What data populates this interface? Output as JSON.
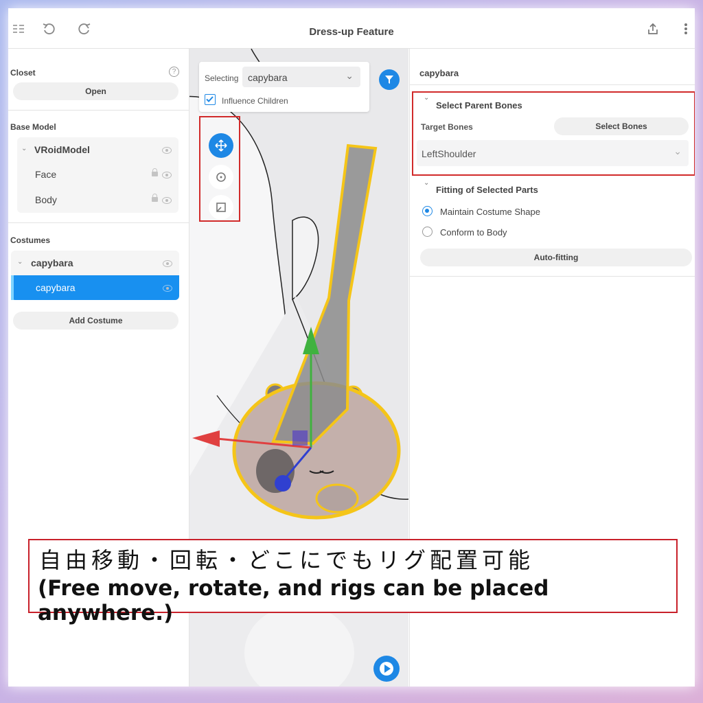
{
  "header": {
    "title": "Dress-up Feature",
    "icons": [
      "menu-icon",
      "undo-icon",
      "redo-icon",
      "share-icon",
      "more-icon"
    ]
  },
  "left_panel": {
    "closet_title": "Closet",
    "open_label": "Open",
    "base_model_title": "Base Model",
    "model_name": "VRoidModel",
    "model_items": [
      "Face",
      "Body"
    ],
    "costumes_title": "Costumes",
    "costume_group": "capybara",
    "costume_selected": "capybara",
    "add_costume_label": "Add Costume"
  },
  "viewport": {
    "selecting_label": "Selecting",
    "selecting_value": "capybara",
    "influence_children_label": "Influence Children",
    "influence_children_checked": true,
    "tools": [
      "move-tool-icon",
      "rotate-tool-icon",
      "scale-tool-icon"
    ]
  },
  "right_panel": {
    "title": "capybara",
    "select_parent_bones_title": "Select Parent Bones",
    "target_bones_label": "Target Bones",
    "select_bones_button": "Select Bones",
    "bone_value": "LeftShoulder",
    "fitting_title": "Fitting of Selected Parts",
    "fitting_options": [
      "Maintain Costume Shape",
      "Conform to Body"
    ],
    "fitting_selected": "Maintain Costume Shape",
    "auto_fitting_label": "Auto-fitting"
  },
  "caption": {
    "japanese": "自由移動・回転・どこにでもリグ配置可能",
    "english": "(Free move, rotate, and rigs can be placed anywhere.)"
  },
  "colors": {
    "accent": "#1e88e5",
    "annotation_red": "#d12a2a",
    "highlight_yellow": "#f5c518"
  }
}
